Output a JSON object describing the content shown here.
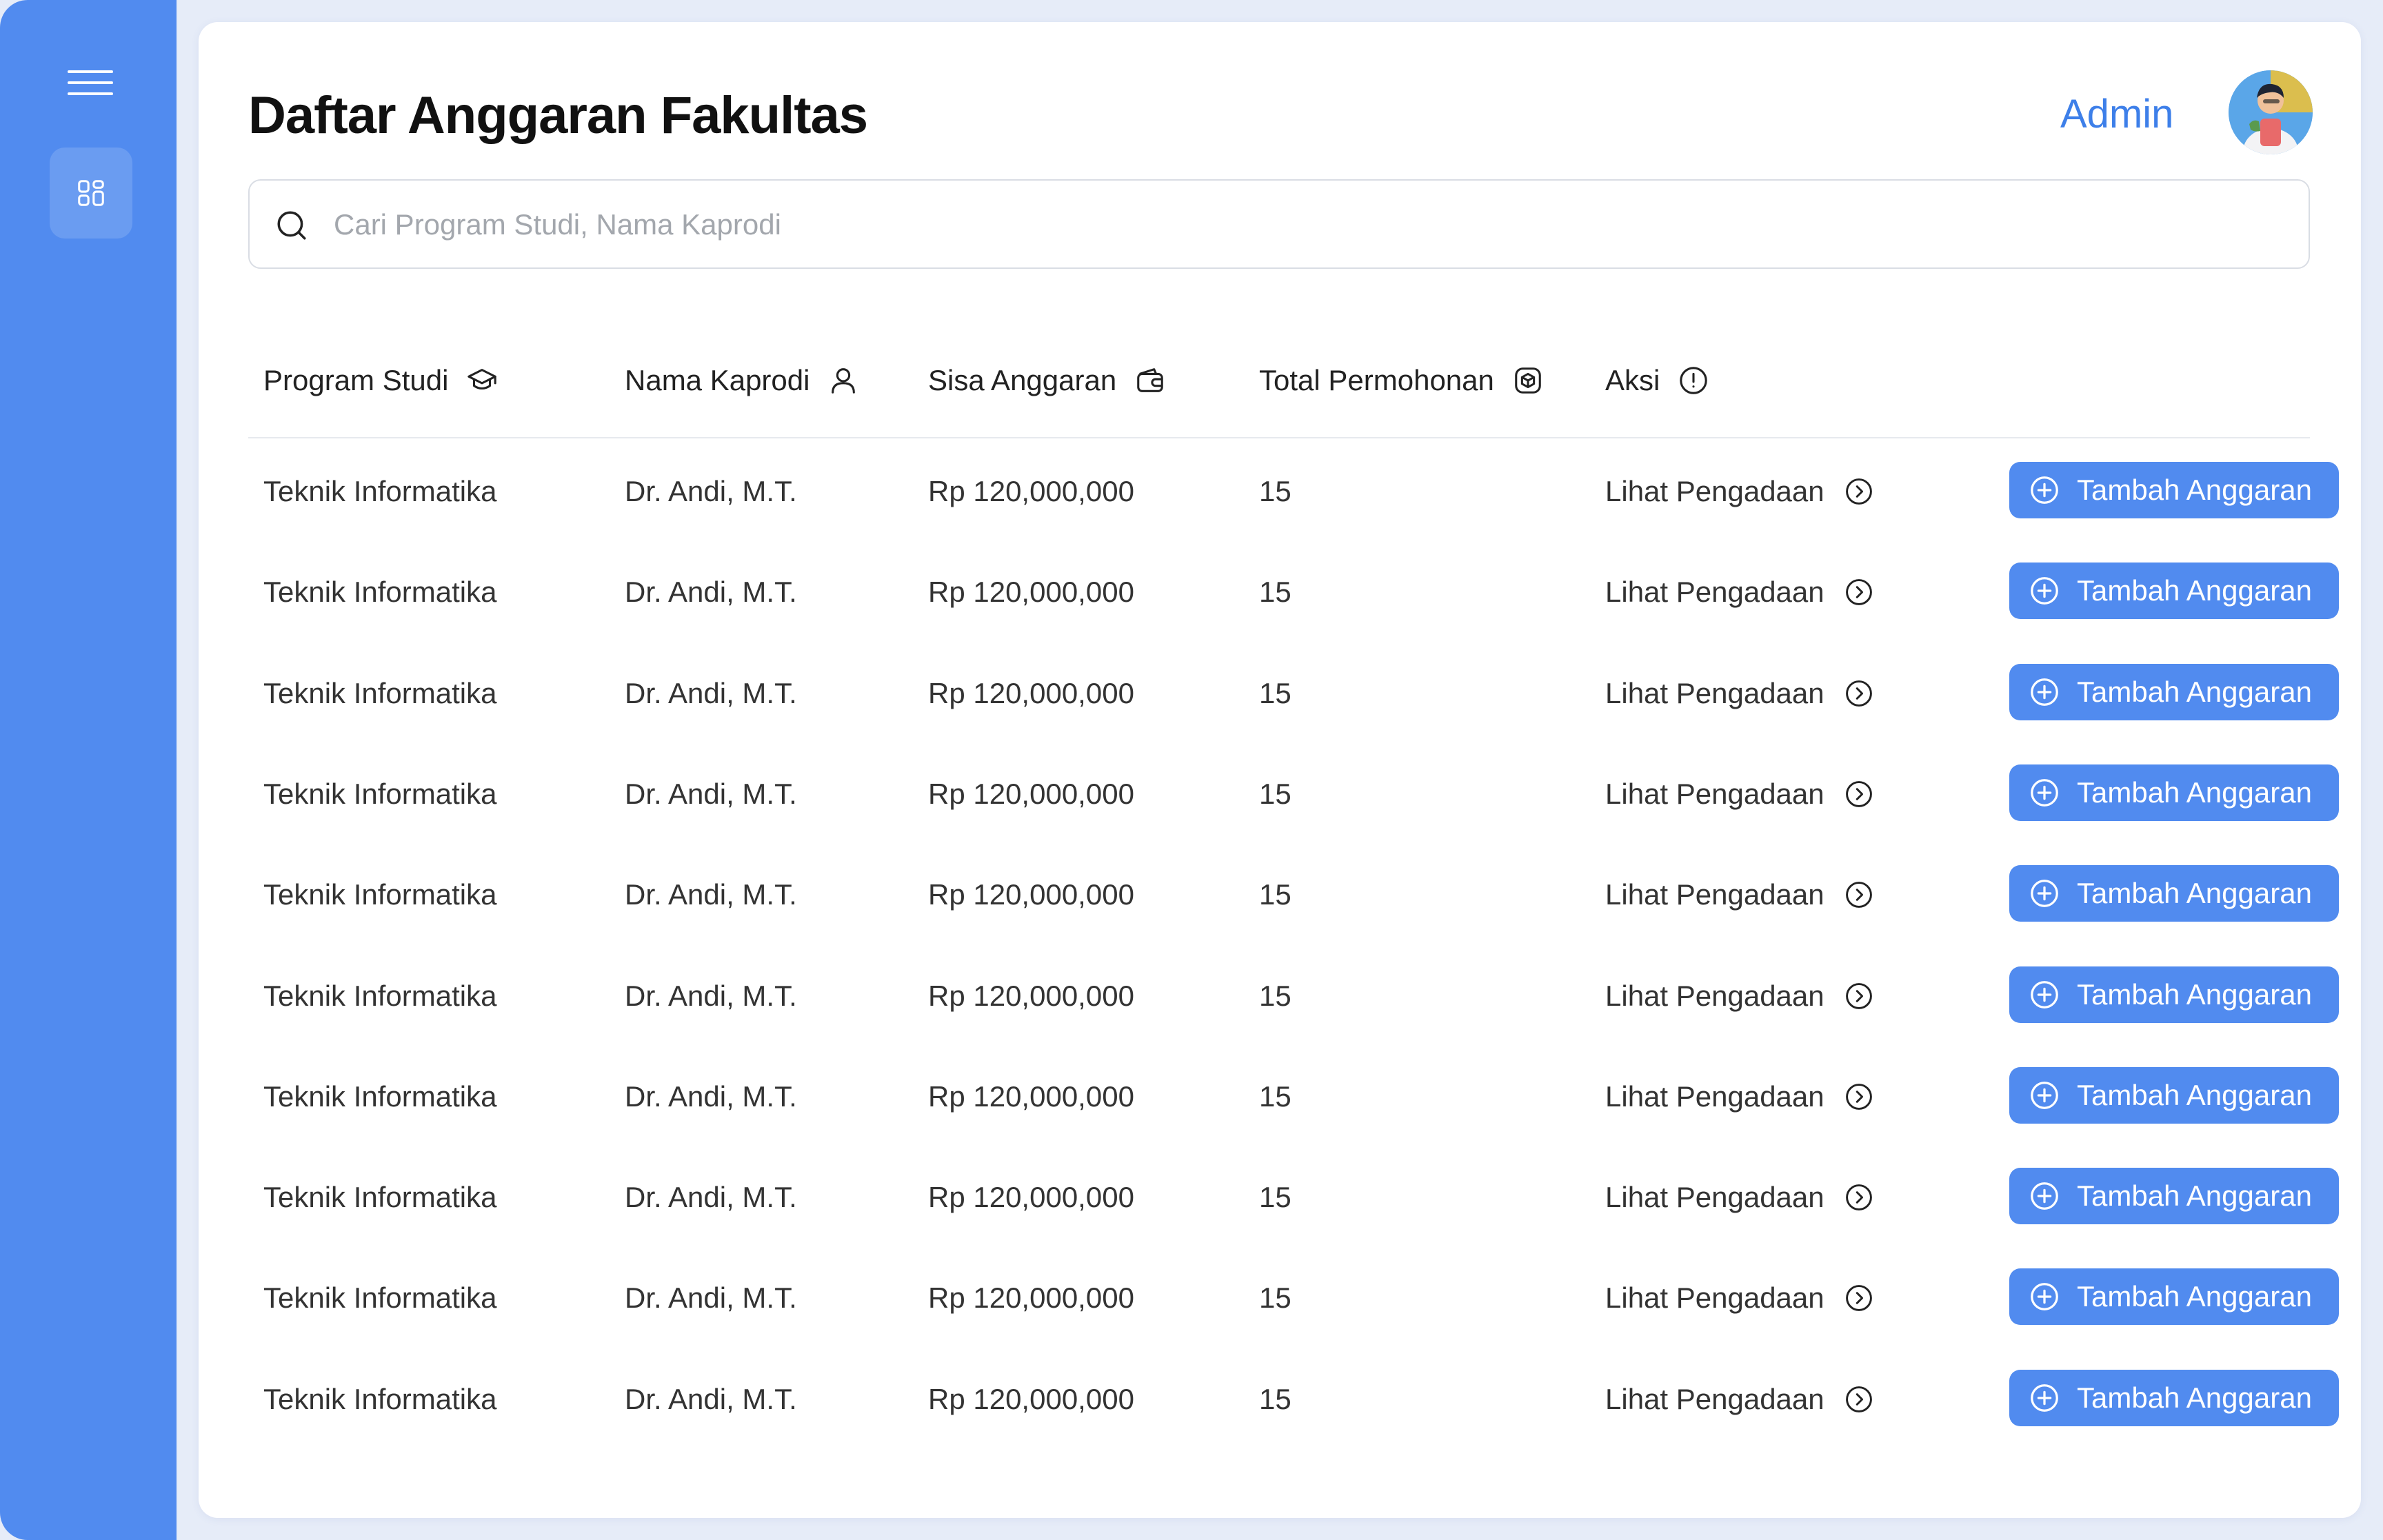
{
  "colors": {
    "accent": "#518bef",
    "admin_text": "#3d7fe9",
    "background": "#e6ecf8"
  },
  "sidebar": {
    "menu_icon": "hamburger-icon",
    "items": [
      {
        "icon": "dashboard-grid-icon",
        "active": true
      }
    ]
  },
  "header": {
    "title": "Daftar Anggaran Fakultas",
    "user_label": "Admin"
  },
  "search": {
    "placeholder": "Cari Program Studi, Nama Kaprodi",
    "value": ""
  },
  "table": {
    "columns": [
      {
        "label": "Program Studi",
        "icon": "graduation-cap-icon"
      },
      {
        "label": "Nama Kaprodi",
        "icon": "user-icon"
      },
      {
        "label": "Sisa Anggaran",
        "icon": "wallet-icon"
      },
      {
        "label": "Total Permohonan",
        "icon": "box-icon"
      },
      {
        "label": "Aksi",
        "icon": "info-icon"
      }
    ],
    "action_link_label": "Lihat Pengadaan",
    "action_button_label": "Tambah Anggaran",
    "rows": [
      {
        "program_studi": "Teknik Informatika",
        "nama_kaprodi": "Dr. Andi, M.T.",
        "sisa_anggaran": "Rp 120,000,000",
        "total_permohonan": "15"
      },
      {
        "program_studi": "Teknik Informatika",
        "nama_kaprodi": "Dr. Andi, M.T.",
        "sisa_anggaran": "Rp 120,000,000",
        "total_permohonan": "15"
      },
      {
        "program_studi": "Teknik Informatika",
        "nama_kaprodi": "Dr. Andi, M.T.",
        "sisa_anggaran": "Rp 120,000,000",
        "total_permohonan": "15"
      },
      {
        "program_studi": "Teknik Informatika",
        "nama_kaprodi": "Dr. Andi, M.T.",
        "sisa_anggaran": "Rp 120,000,000",
        "total_permohonan": "15"
      },
      {
        "program_studi": "Teknik Informatika",
        "nama_kaprodi": "Dr. Andi, M.T.",
        "sisa_anggaran": "Rp 120,000,000",
        "total_permohonan": "15"
      },
      {
        "program_studi": "Teknik Informatika",
        "nama_kaprodi": "Dr. Andi, M.T.",
        "sisa_anggaran": "Rp 120,000,000",
        "total_permohonan": "15"
      },
      {
        "program_studi": "Teknik Informatika",
        "nama_kaprodi": "Dr. Andi, M.T.",
        "sisa_anggaran": "Rp 120,000,000",
        "total_permohonan": "15"
      },
      {
        "program_studi": "Teknik Informatika",
        "nama_kaprodi": "Dr. Andi, M.T.",
        "sisa_anggaran": "Rp 120,000,000",
        "total_permohonan": "15"
      },
      {
        "program_studi": "Teknik Informatika",
        "nama_kaprodi": "Dr. Andi, M.T.",
        "sisa_anggaran": "Rp 120,000,000",
        "total_permohonan": "15"
      },
      {
        "program_studi": "Teknik Informatika",
        "nama_kaprodi": "Dr. Andi, M.T.",
        "sisa_anggaran": "Rp 120,000,000",
        "total_permohonan": "15"
      }
    ]
  }
}
